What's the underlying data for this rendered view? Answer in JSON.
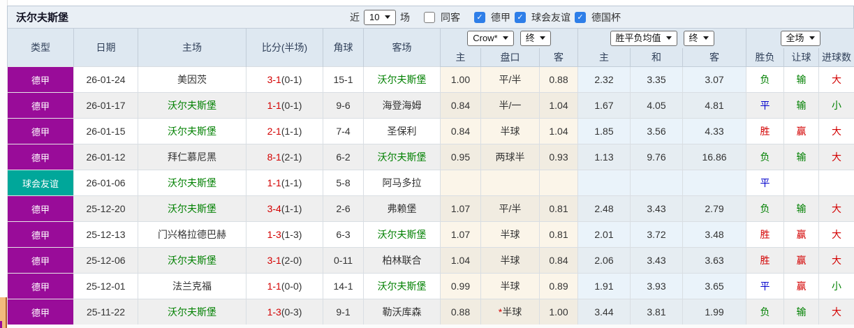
{
  "panel": {
    "title": "沃尔夫斯堡",
    "filter": {
      "near_label": "近",
      "near_value": "10",
      "games_label": "场",
      "checkboxes": [
        {
          "label": "同客",
          "checked": false
        },
        {
          "label": "德甲",
          "checked": true
        },
        {
          "label": "球会友谊",
          "checked": true
        },
        {
          "label": "德国杯",
          "checked": true
        }
      ]
    }
  },
  "table": {
    "team_name": "沃尔夫斯堡",
    "headers": {
      "type": "类型",
      "date": "日期",
      "home": "主场",
      "score": "比分(半场)",
      "corner": "角球",
      "away": "客场",
      "odds_company_select": "Crow*",
      "odds_stage_select": "终",
      "mean_select": "胜平负均值",
      "mean_stage_select": "终",
      "full_match_select": "全场",
      "sub_odds_home": "主",
      "sub_handicap": "盘口",
      "sub_odds_away": "客",
      "sub_mean_home": "主",
      "sub_mean_draw": "和",
      "sub_mean_away": "客",
      "sub_result": "胜负",
      "sub_handicap_result": "让球",
      "sub_goals": "进球数"
    },
    "rows": [
      {
        "type": "德甲",
        "date": "26-01-24",
        "home": "美因茨",
        "score_ft": "3-1",
        "score_ht": "(0-1)",
        "corner": "15-1",
        "away": "沃尔夫斯堡",
        "odds_home": "1.00",
        "handicap_star": "",
        "handicap": "平/半",
        "odds_away": "0.88",
        "mean_home": "2.32",
        "mean_draw": "3.35",
        "mean_away": "3.07",
        "result": "负",
        "handicap_result": "输",
        "goals": "大"
      },
      {
        "type": "德甲",
        "date": "26-01-17",
        "home": "沃尔夫斯堡",
        "score_ft": "1-1",
        "score_ht": "(0-1)",
        "corner": "9-6",
        "away": "海登海姆",
        "odds_home": "0.84",
        "handicap_star": "",
        "handicap": "半/一",
        "odds_away": "1.04",
        "mean_home": "1.67",
        "mean_draw": "4.05",
        "mean_away": "4.81",
        "result": "平",
        "handicap_result": "输",
        "goals": "小"
      },
      {
        "type": "德甲",
        "date": "26-01-15",
        "home": "沃尔夫斯堡",
        "score_ft": "2-1",
        "score_ht": "(1-1)",
        "corner": "7-4",
        "away": "圣保利",
        "odds_home": "0.84",
        "handicap_star": "",
        "handicap": "半球",
        "odds_away": "1.04",
        "mean_home": "1.85",
        "mean_draw": "3.56",
        "mean_away": "4.33",
        "result": "胜",
        "handicap_result": "赢",
        "goals": "大"
      },
      {
        "type": "德甲",
        "date": "26-01-12",
        "home": "拜仁慕尼黑",
        "score_ft": "8-1",
        "score_ht": "(2-1)",
        "corner": "6-2",
        "away": "沃尔夫斯堡",
        "odds_home": "0.95",
        "handicap_star": "",
        "handicap": "两球半",
        "odds_away": "0.93",
        "mean_home": "1.13",
        "mean_draw": "9.76",
        "mean_away": "16.86",
        "result": "负",
        "handicap_result": "输",
        "goals": "大"
      },
      {
        "type": "球会友谊",
        "date": "26-01-06",
        "home": "沃尔夫斯堡",
        "score_ft": "1-1",
        "score_ht": "(1-1)",
        "corner": "5-8",
        "away": "阿马多拉",
        "odds_home": "",
        "handicap_star": "",
        "handicap": "",
        "odds_away": "",
        "mean_home": "",
        "mean_draw": "",
        "mean_away": "",
        "result": "平",
        "handicap_result": "",
        "goals": ""
      },
      {
        "type": "德甲",
        "date": "25-12-20",
        "home": "沃尔夫斯堡",
        "score_ft": "3-4",
        "score_ht": "(1-1)",
        "corner": "2-6",
        "away": "弗赖堡",
        "odds_home": "1.07",
        "handicap_star": "",
        "handicap": "平/半",
        "odds_away": "0.81",
        "mean_home": "2.48",
        "mean_draw": "3.43",
        "mean_away": "2.79",
        "result": "负",
        "handicap_result": "输",
        "goals": "大"
      },
      {
        "type": "德甲",
        "date": "25-12-13",
        "home": "门兴格拉德巴赫",
        "score_ft": "1-3",
        "score_ht": "(1-3)",
        "corner": "6-3",
        "away": "沃尔夫斯堡",
        "odds_home": "1.07",
        "handicap_star": "",
        "handicap": "半球",
        "odds_away": "0.81",
        "mean_home": "2.01",
        "mean_draw": "3.72",
        "mean_away": "3.48",
        "result": "胜",
        "handicap_result": "赢",
        "goals": "大"
      },
      {
        "type": "德甲",
        "date": "25-12-06",
        "home": "沃尔夫斯堡",
        "score_ft": "3-1",
        "score_ht": "(2-0)",
        "corner": "0-11",
        "away": "柏林联合",
        "odds_home": "1.04",
        "handicap_star": "",
        "handicap": "半球",
        "odds_away": "0.84",
        "mean_home": "2.06",
        "mean_draw": "3.43",
        "mean_away": "3.63",
        "result": "胜",
        "handicap_result": "赢",
        "goals": "大"
      },
      {
        "type": "德甲",
        "date": "25-12-01",
        "home": "法兰克福",
        "score_ft": "1-1",
        "score_ht": "(0-0)",
        "corner": "14-1",
        "away": "沃尔夫斯堡",
        "odds_home": "0.99",
        "handicap_star": "",
        "handicap": "半球",
        "odds_away": "0.89",
        "mean_home": "1.91",
        "mean_draw": "3.93",
        "mean_away": "3.65",
        "result": "平",
        "handicap_result": "赢",
        "goals": "小"
      },
      {
        "type": "德甲",
        "date": "25-11-22",
        "home": "沃尔夫斯堡",
        "score_ft": "1-3",
        "score_ht": "(0-3)",
        "corner": "9-1",
        "away": "勒沃库森",
        "odds_home": "0.88",
        "handicap_star": "*",
        "handicap": "半球",
        "odds_away": "1.00",
        "mean_home": "3.44",
        "mean_draw": "3.81",
        "mean_away": "1.99",
        "result": "负",
        "handicap_result": "输",
        "goals": "大"
      }
    ]
  },
  "colors": {
    "league_dejia": "#990c99",
    "league_friendly": "#00a79a",
    "win_red": "#d30000",
    "loss_green": "#008000",
    "draw_blue": "#0000cc",
    "checkbox_blue": "#2e7ee8"
  }
}
